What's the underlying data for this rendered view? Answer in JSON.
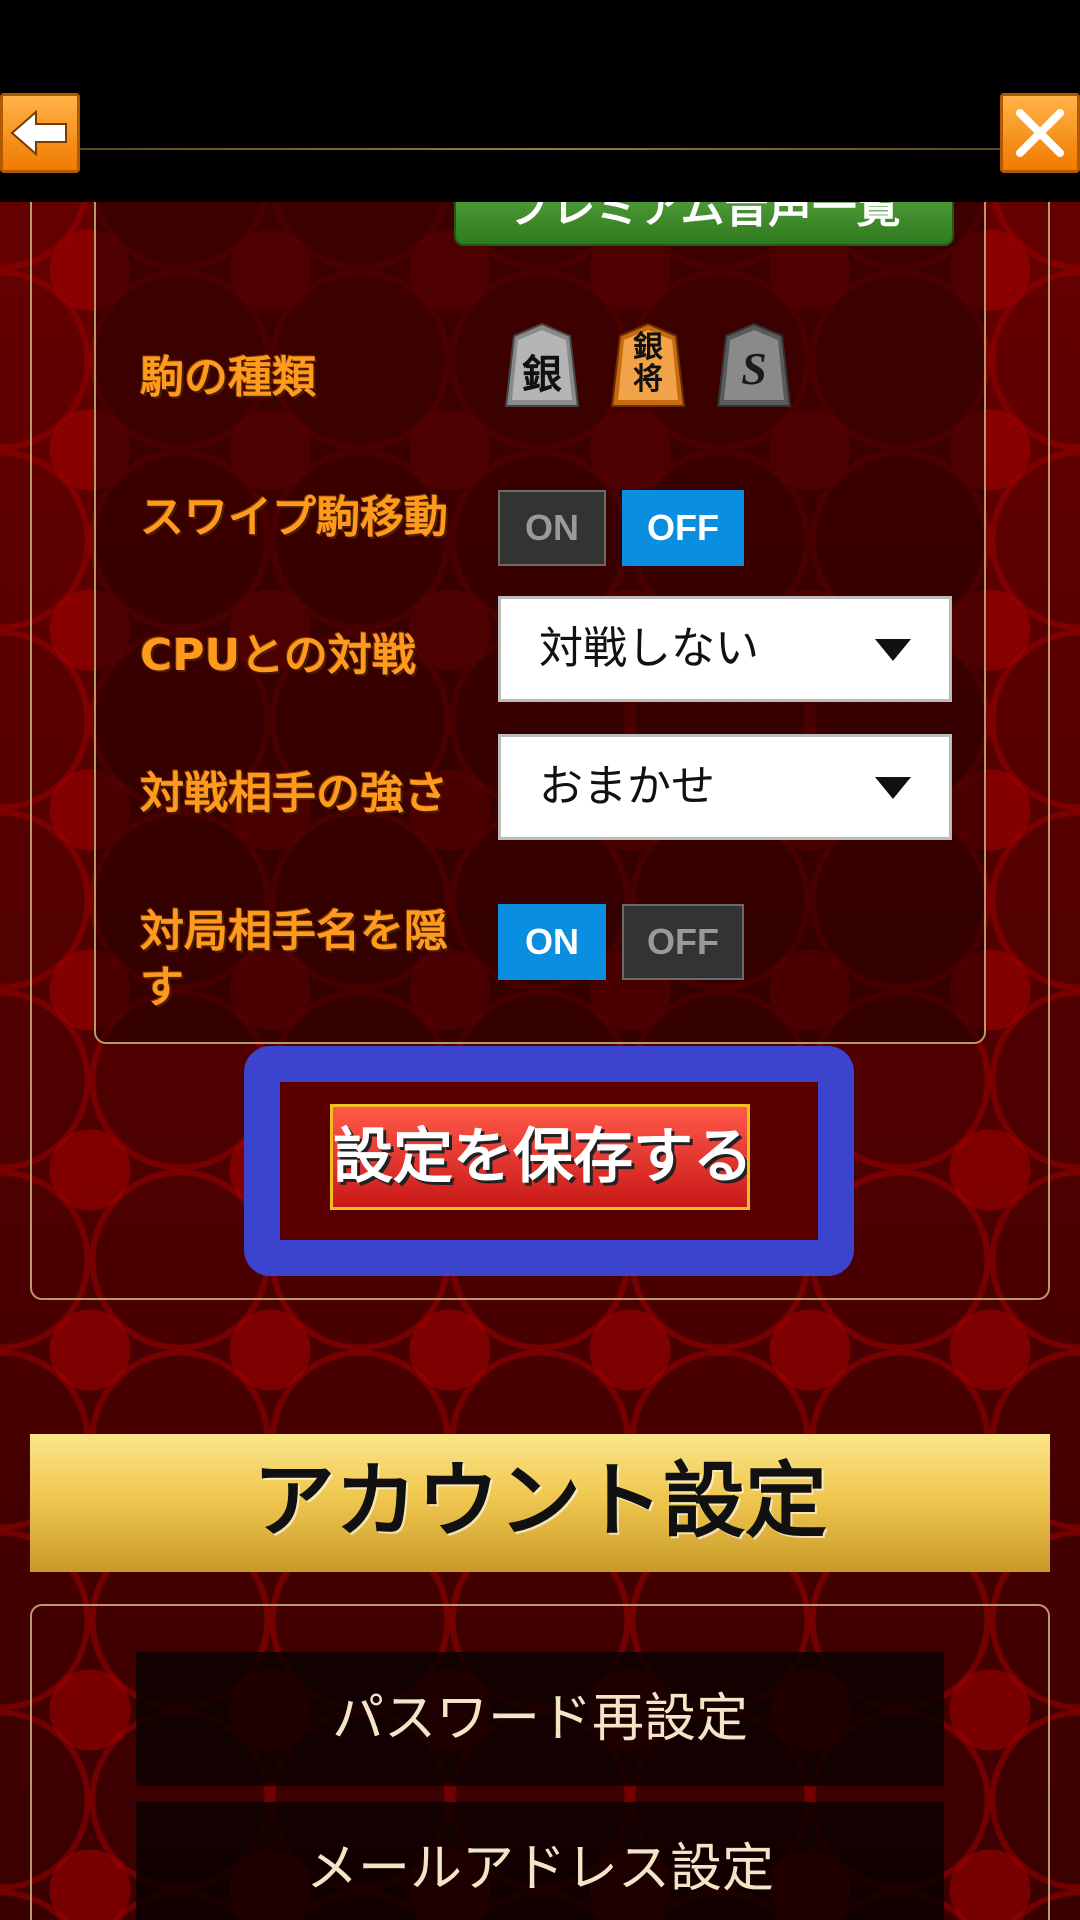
{
  "header": {
    "back_icon": "arrow-left-icon",
    "close_icon": "close-icon"
  },
  "game_settings": {
    "premium_voice_button": "プレミアム音声一覧",
    "piece_type": {
      "label": "駒の種類",
      "options": [
        "銀",
        "銀将",
        "S"
      ],
      "selected_index": 1
    },
    "swipe_move": {
      "label": "スワイプ駒移動",
      "on_label": "ON",
      "off_label": "OFF",
      "value": "OFF"
    },
    "cpu_match": {
      "label": "CPUとの対戦",
      "value": "対戦しない"
    },
    "opponent_strength": {
      "label": "対戦相手の強さ",
      "value": "おまかせ"
    },
    "hide_opponent_name": {
      "label": "対局相手名を隠す",
      "on_label": "ON",
      "off_label": "OFF",
      "value": "ON"
    },
    "save_button": "設定を保存する"
  },
  "account": {
    "title": "アカウント設定",
    "items": [
      "パスワード再設定",
      "メールアドレス設定"
    ]
  },
  "colors": {
    "accent_orange": "#ff9a1e",
    "toggle_active": "#0a8ee0",
    "highlight_frame": "#3a44cc",
    "gold": "#f0c850"
  }
}
